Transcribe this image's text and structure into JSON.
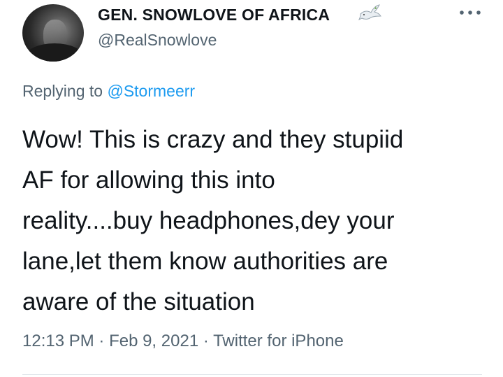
{
  "author": {
    "display_name": "GEN. SNOWLOVE OF AFRICA",
    "handle": "@RealSnowlove",
    "name_emoji": "dove-icon"
  },
  "reply": {
    "prefix": "Replying to ",
    "mention": "@Stormeerr"
  },
  "tweet": {
    "text": "Wow! This is crazy and they stupiid\nAF for allowing this into\nreality....buy headphones,dey your\nlane,let them know authorities are\naware of the situation"
  },
  "meta": {
    "time": "12:13 PM",
    "sep1": " · ",
    "date": "Feb 9, 2021",
    "sep2": " · ",
    "source": "Twitter for iPhone"
  },
  "colors": {
    "text": "#0f1419",
    "secondary": "#536471",
    "link": "#1d9bf0"
  }
}
